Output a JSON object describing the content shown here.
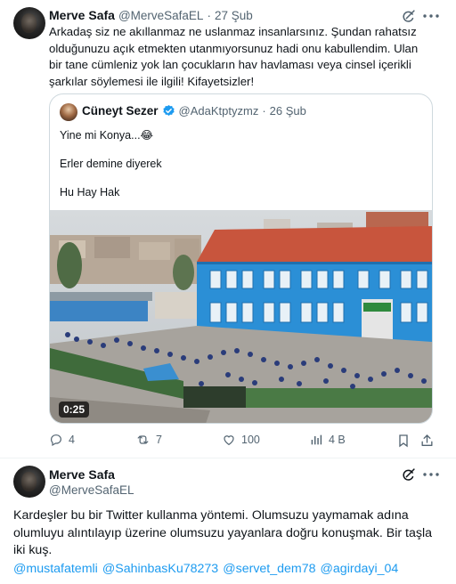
{
  "tweet1": {
    "author_name": "Merve Safa",
    "author_handle": "@MerveSafaEL",
    "separator": "·",
    "date": "27 Şub",
    "text": "Arkadaş siz ne akıllanmaz ne uslanmaz insanlarsınız. Şundan rahatsız olduğunuzu açık etmekten utanmıyorsunuz hadi onu kabullendim. Ulan bir tane cümleniz yok lan çocukların hav havlaması veya cinsel içerikli şarkılar söylemesi ile ilgili!  Kifayetsizler!",
    "quote": {
      "author_name": "Cüneyt Sezer",
      "author_handle": "@AdaKtptyzmz",
      "separator": "·",
      "date": "26 Şub",
      "line1": "Yine mi Konya...😂",
      "line2": "Erler demine diyerek",
      "line3": "Hu Hay Hak",
      "video_duration": "0:25"
    },
    "actions": {
      "replies": "4",
      "reposts": "7",
      "likes": "100",
      "views": "4 B"
    }
  },
  "tweet2": {
    "author_name": "Merve Safa",
    "author_handle": "@MerveSafaEL",
    "text": "Kardeşler bu bir Twitter kullanma yöntemi. Olumsuzu yaymamak adına olumluyu alıntılayıp üzerine olumsuzu yayanlara doğru konuşmak. Bir taşla iki kuş.",
    "mentions": [
      "@mustafatemli",
      "@SahinbasKu78273",
      "@servet_dem78",
      "@agirdayi_04"
    ]
  },
  "colors": {
    "text": "#0f1419",
    "muted": "#536471",
    "link": "#1d9bf0",
    "border": "#cfd9de",
    "verified": "#1d9bf0",
    "building": "#2b8fd6",
    "roof": "#c8553d"
  },
  "icons": [
    "grok-icon",
    "more-icon",
    "verified-badge-icon",
    "reply-icon",
    "repost-icon",
    "like-icon",
    "views-icon",
    "bookmark-icon",
    "share-icon"
  ]
}
